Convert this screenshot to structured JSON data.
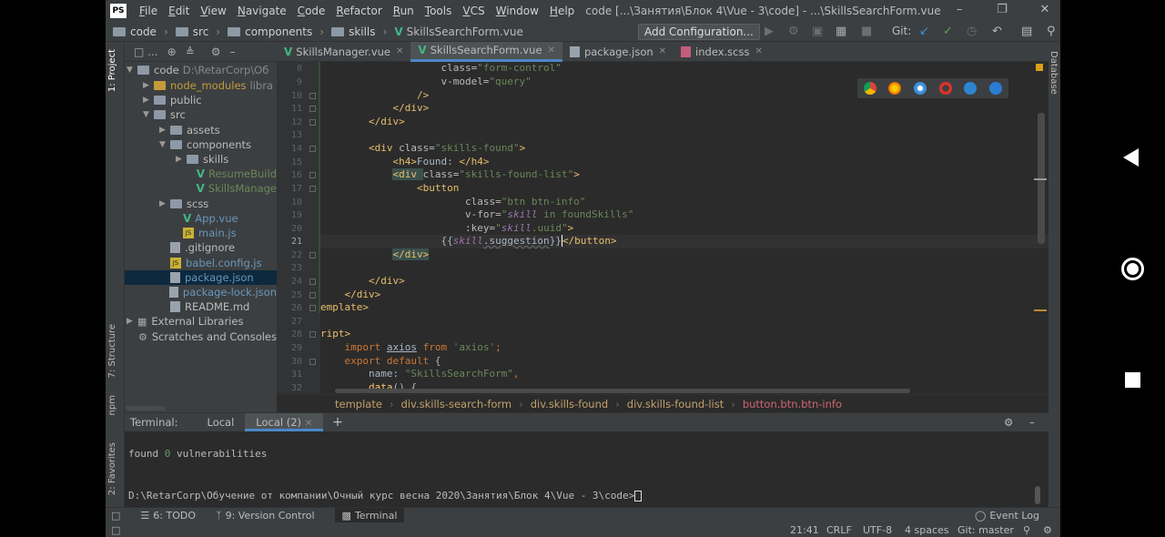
{
  "window": {
    "app_logo": "PS",
    "menu": [
      "File",
      "Edit",
      "View",
      "Navigate",
      "Code",
      "Refactor",
      "Run",
      "Tools",
      "VCS",
      "Window",
      "Help"
    ],
    "title": "code [...\\Занятия\\Блок 4\\Vue - 3\\code] - ...\\SkillsSearchForm.vue"
  },
  "navbar": {
    "crumbs": [
      "code",
      "src",
      "components",
      "skills",
      "SkillsSearchForm.vue"
    ],
    "add_configuration": "Add Configuration...",
    "git_label": "Git:"
  },
  "left_stripe": {
    "project": "1: Project",
    "structure": "7: Structure",
    "npm": "npm",
    "favorites": "2: Favorites"
  },
  "right_stripe": {
    "database": "Database"
  },
  "tree": [
    {
      "label": "code",
      "extra": "D:\\RetarCorp\\Об",
      "type": "folder",
      "expanded": true
    },
    {
      "label": "node_modules",
      "extra": "libra",
      "type": "folder-orange"
    },
    {
      "label": "public",
      "type": "folder"
    },
    {
      "label": "src",
      "type": "folder",
      "expanded": true
    },
    {
      "label": "assets",
      "type": "folder"
    },
    {
      "label": "components",
      "type": "folder",
      "expanded": true
    },
    {
      "label": "skills",
      "type": "folder"
    },
    {
      "label": "ResumeBuild",
      "type": "vue"
    },
    {
      "label": "SkillsManage",
      "type": "vue"
    },
    {
      "label": "scss",
      "type": "folder"
    },
    {
      "label": "App.vue",
      "type": "vue"
    },
    {
      "label": "main.js",
      "type": "js"
    },
    {
      "label": ".gitignore",
      "type": "file"
    },
    {
      "label": "babel.config.js",
      "type": "js"
    },
    {
      "label": "package.json",
      "type": "file",
      "selected": true
    },
    {
      "label": "package-lock.json",
      "type": "file"
    },
    {
      "label": "README.md",
      "type": "file"
    },
    {
      "label": "External Libraries",
      "type": "lib"
    },
    {
      "label": "Scratches and Consoles",
      "type": "scratch"
    }
  ],
  "tabs": [
    {
      "label": "SkillsManager.vue",
      "type": "vue"
    },
    {
      "label": "SkillsSearchForm.vue",
      "type": "vue",
      "active": true
    },
    {
      "label": "package.json",
      "type": "pkg"
    },
    {
      "label": "index.scss",
      "type": "scss"
    }
  ],
  "code_lines": [
    {
      "n": "8"
    },
    {
      "n": "9"
    },
    {
      "n": "10"
    },
    {
      "n": "11"
    },
    {
      "n": "12"
    },
    {
      "n": "13"
    },
    {
      "n": "14"
    },
    {
      "n": "15"
    },
    {
      "n": "16"
    },
    {
      "n": "17"
    },
    {
      "n": "18"
    },
    {
      "n": "19"
    },
    {
      "n": "20"
    },
    {
      "n": "21"
    },
    {
      "n": "22"
    },
    {
      "n": "23"
    },
    {
      "n": "24"
    },
    {
      "n": "25"
    },
    {
      "n": "26"
    },
    {
      "n": "27"
    },
    {
      "n": "28"
    },
    {
      "n": "29"
    },
    {
      "n": "30"
    },
    {
      "n": "31"
    },
    {
      "n": "32"
    }
  ],
  "code_text": {
    "l8a": "class=",
    "l8b": "\"form-control\"",
    "l9a": "v-model=",
    "l9b": "\"query\"",
    "l10": "/>",
    "l11": "</div>",
    "l12": "</div>",
    "l14a": "<div ",
    "l14b": "class=",
    "l14c": "\"skills-found\"",
    "l14d": ">",
    "l15a": "<h4>",
    "l15b": "Found: ",
    "l15c": "</h4>",
    "l16a": "<div ",
    "l16b": "class=",
    "l16c": "\"skills-found-list\"",
    "l16d": ">",
    "l17": "<button",
    "l18a": "class=",
    "l18b": "\"btn btn-info\"",
    "l19a": "v-for=",
    "l19b": "\"",
    "l19c": "skill",
    "l19d": " in foundSkills\"",
    "l20a": ":key=",
    "l20b": "\"",
    "l20c": "skill",
    "l20d": ".uuid\"",
    "l20e": ">",
    "l21a": "{{",
    "l21b": "skill",
    "l21c": ".suggestion",
    "l21d": "}}",
    "l21e": "</button>",
    "l22": "</div>",
    "l24": "</div>",
    "l25": "</div>",
    "l26": "emplate>",
    "l28": "ript>",
    "l29a": "import ",
    "l29b": "axios",
    "l29c": " from ",
    "l29d": "'axios'",
    "l29e": ";",
    "l30a": "export default ",
    "l30b": "{",
    "l31a": "name: ",
    "l31b": "\"SkillsSearchForm\"",
    "l31c": ",",
    "l32a": "data",
    "l32b": "() {"
  },
  "editor_breadcrumb": [
    "template",
    "div.skills-search-form",
    "div.skills-found",
    "div.skills-found-list",
    "button.btn.btn-info"
  ],
  "terminal": {
    "label": "Terminal:",
    "tabs": [
      "Local",
      "Local (2)"
    ],
    "active_tab": 1,
    "line1a": "found ",
    "line1b": "0",
    "line1c": " vulnerabilities",
    "prompt": "D:\\RetarCorp\\Обучение от компании\\Очный курс весна 2020\\Занятия\\Блок 4\\Vue - 3\\code>"
  },
  "bottom_tools": [
    "6: TODO",
    "9: Version Control",
    "Terminal"
  ],
  "event_log": "Event Log",
  "status": {
    "position": "21:41",
    "line_sep": "CRLF",
    "encoding": "UTF-8",
    "indent": "4 spaces",
    "git": "Git: master"
  }
}
